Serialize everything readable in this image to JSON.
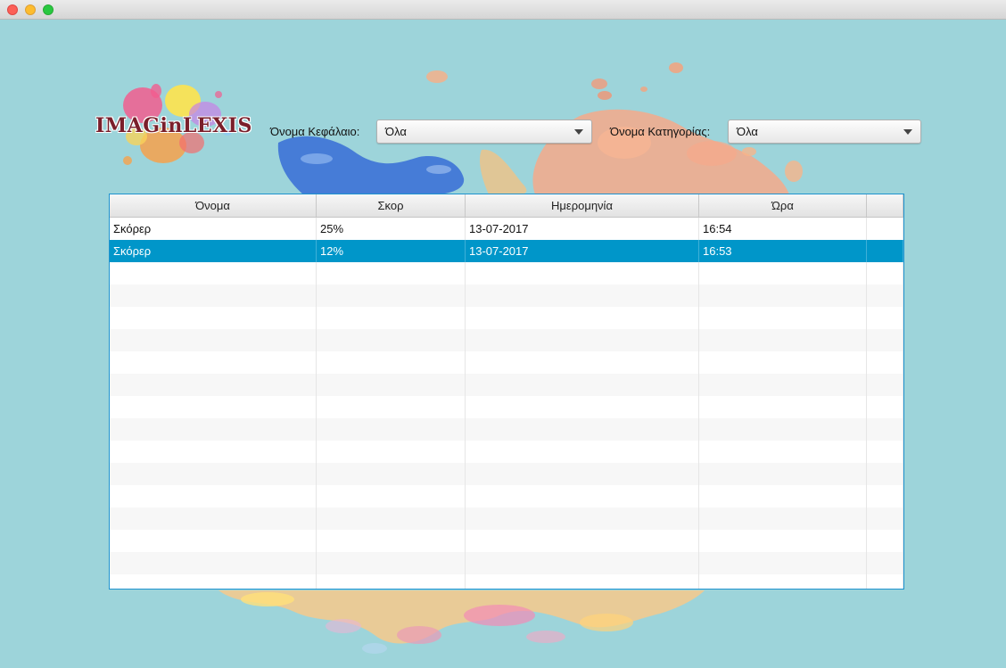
{
  "window": {
    "title": ""
  },
  "logo": {
    "text": "IMAGinLEXIS"
  },
  "filters": {
    "chapter": {
      "label": "Όνομα Κεφάλαιο:",
      "value": "Όλα"
    },
    "category": {
      "label": "Όνομα Κατηγορίας:",
      "value": "Όλα"
    }
  },
  "table": {
    "columns": [
      "Όνομα",
      "Σκορ",
      "Ημερομηνία",
      "Ώρα"
    ],
    "rows": [
      {
        "name": "Σκόρερ",
        "score": "25%",
        "date": "13-07-2017",
        "time": "16:54"
      },
      {
        "name": "Σκόρερ",
        "score": "12%",
        "date": "13-07-2017",
        "time": "16:53"
      }
    ],
    "selected_row": 1
  },
  "colors": {
    "background": "#9dd4da",
    "selection": "#0096c9",
    "table_border": "#1e93cf"
  }
}
